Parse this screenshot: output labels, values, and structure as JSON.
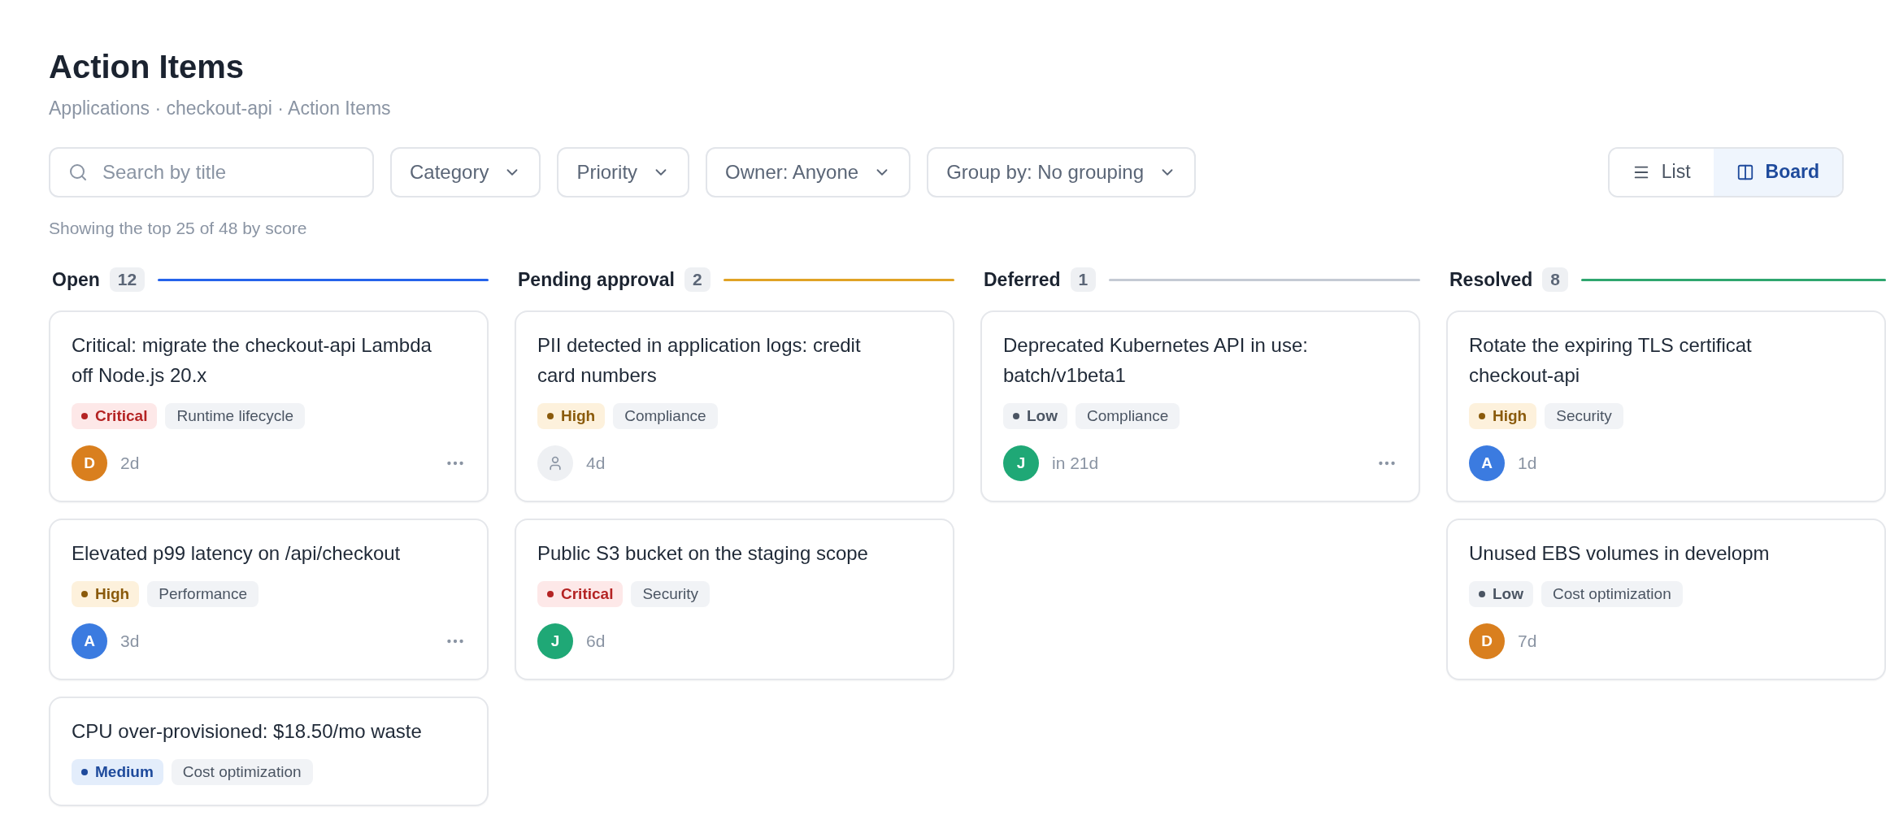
{
  "page": {
    "title": "Action Items",
    "breadcrumb": "Applications · checkout-api · Action Items"
  },
  "toolbar": {
    "search": {
      "placeholder": "Search by title"
    },
    "filters": [
      {
        "label": "Category"
      },
      {
        "label": "Priority"
      },
      {
        "label": "Owner: Anyone"
      },
      {
        "label": "Group by: No grouping"
      }
    ],
    "views": [
      {
        "label": "List",
        "kind": "list",
        "selected": false
      },
      {
        "label": "Board",
        "kind": "board",
        "selected": true
      }
    ]
  },
  "summary": "Showing the top 25 of 48 by score",
  "columns": [
    {
      "name": "Open",
      "count": "12",
      "color": "#2563eb",
      "cards": [
        {
          "title_lines": [
            "Critical: migrate the checkout-api Lambda",
            "off Node.js 20.x"
          ],
          "priority": {
            "label": "Critical",
            "kind": "critical"
          },
          "category": "Runtime lifecycle",
          "owner": {
            "kind": "person",
            "initial": "D",
            "color": "#d97f1e"
          },
          "age": "2d",
          "menu": true
        },
        {
          "title_lines": [
            "Elevated p99 latency on /api/checkout"
          ],
          "priority": {
            "label": "High",
            "kind": "high"
          },
          "category": "Performance",
          "owner": {
            "kind": "person",
            "initial": "A",
            "color": "#3b7be0"
          },
          "age": "3d",
          "menu": true
        },
        {
          "title_lines": [
            "CPU over-provisioned: $18.50/mo waste"
          ],
          "priority": {
            "label": "Medium",
            "kind": "medium"
          },
          "category": "Cost optimization"
        }
      ]
    },
    {
      "name": "Pending approval",
      "count": "2",
      "color": "#e0a325",
      "cards": [
        {
          "title_lines": [
            "PII detected in application logs: credit",
            "card numbers"
          ],
          "priority": {
            "label": "High",
            "kind": "high"
          },
          "category": "Compliance",
          "owner": {
            "kind": "unassigned"
          },
          "age": "4d"
        },
        {
          "title_lines": [
            "Public S3 bucket on the staging scope"
          ],
          "priority": {
            "label": "Critical",
            "kind": "critical"
          },
          "category": "Security",
          "owner": {
            "kind": "person",
            "initial": "J",
            "color": "#1fa876"
          },
          "age": "6d"
        }
      ]
    },
    {
      "name": "Deferred",
      "count": "1",
      "color": "#c4cad4",
      "cards": [
        {
          "title_lines": [
            "Deprecated Kubernetes API in use:",
            "batch/v1beta1"
          ],
          "priority": {
            "label": "Low",
            "kind": "low"
          },
          "category": "Compliance",
          "owner": {
            "kind": "person",
            "initial": "J",
            "color": "#1fa876"
          },
          "age": "in 21d",
          "menu": true
        }
      ]
    },
    {
      "name": "Resolved",
      "count": "8",
      "color": "#2fa66f",
      "cards": [
        {
          "title_lines": [
            "Rotate the expiring TLS certificat",
            "checkout-api"
          ],
          "priority": {
            "label": "High",
            "kind": "high"
          },
          "category": "Security",
          "owner": {
            "kind": "person",
            "initial": "A",
            "color": "#3b7be0"
          },
          "age": "1d"
        },
        {
          "title_lines": [
            "Unused EBS volumes in developm"
          ],
          "priority": {
            "label": "Low",
            "kind": "low"
          },
          "category": "Cost optimization",
          "owner": {
            "kind": "person",
            "initial": "D",
            "color": "#d97f1e"
          },
          "age": "7d"
        }
      ]
    }
  ]
}
